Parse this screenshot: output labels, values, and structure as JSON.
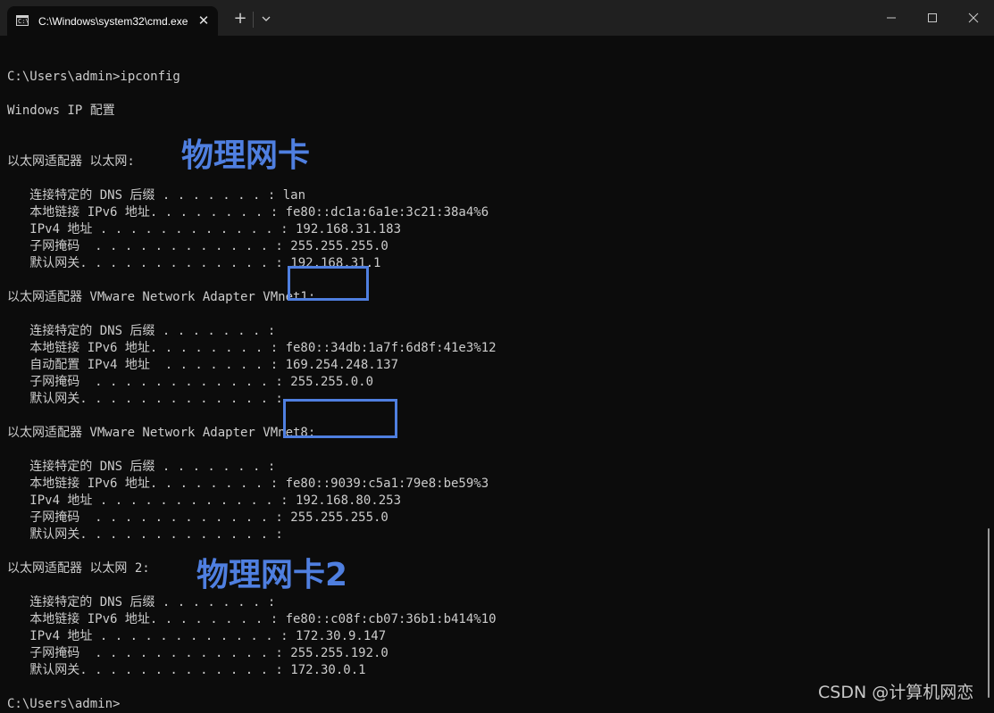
{
  "window": {
    "tab_title": "C:\\Windows\\system32\\cmd.exe",
    "tab_icon_text": "C:\\",
    "tab_close": "✕",
    "new_tab": "+",
    "minimize": "─",
    "maximize": "☐",
    "close": "✕"
  },
  "terminal": {
    "lines": [
      "",
      "C:\\Users\\admin>ipconfig",
      "",
      "Windows IP 配置",
      "",
      "",
      "以太网适配器 以太网:",
      "",
      "   连接特定的 DNS 后缀 . . . . . . . : lan",
      "   本地链接 IPv6 地址. . . . . . . . : fe80::dc1a:6a1e:3c21:38a4%6",
      "   IPv4 地址 . . . . . . . . . . . . : 192.168.31.183",
      "   子网掩码  . . . . . . . . . . . . : 255.255.255.0",
      "   默认网关. . . . . . . . . . . . . : 192.168.31.1",
      "",
      "以太网适配器 VMware Network Adapter VMnet1:",
      "",
      "   连接特定的 DNS 后缀 . . . . . . . :",
      "   本地链接 IPv6 地址. . . . . . . . : fe80::34db:1a7f:6d8f:41e3%12",
      "   自动配置 IPv4 地址  . . . . . . . : 169.254.248.137",
      "   子网掩码  . . . . . . . . . . . . : 255.255.0.0",
      "   默认网关. . . . . . . . . . . . . :",
      "",
      "以太网适配器 VMware Network Adapter VMnet8:",
      "",
      "   连接特定的 DNS 后缀 . . . . . . . :",
      "   本地链接 IPv6 地址. . . . . . . . : fe80::9039:c5a1:79e8:be59%3",
      "   IPv4 地址 . . . . . . . . . . . . : 192.168.80.253",
      "   子网掩码  . . . . . . . . . . . . : 255.255.255.0",
      "   默认网关. . . . . . . . . . . . . :",
      "",
      "以太网适配器 以太网 2:",
      "",
      "   连接特定的 DNS 后缀 . . . . . . . :",
      "   本地链接 IPv6 地址. . . . . . . . : fe80::c08f:cb07:36b1:b414%10",
      "   IPv4 地址 . . . . . . . . . . . . : 172.30.9.147",
      "   子网掩码  . . . . . . . . . . . . : 255.255.192.0",
      "   默认网关. . . . . . . . . . . . . : 172.30.0.1",
      "",
      "C:\\Users\\admin>"
    ]
  },
  "annotations": {
    "label_1": "物理网卡",
    "label_2": "物理网卡2",
    "color": "#4f7fe0"
  },
  "watermark": "CSDN @计算机网恋",
  "colors": {
    "background": "#0c0c0c",
    "titlebar": "#202020",
    "text": "#cccccc",
    "annotation": "#4f7fe0"
  }
}
